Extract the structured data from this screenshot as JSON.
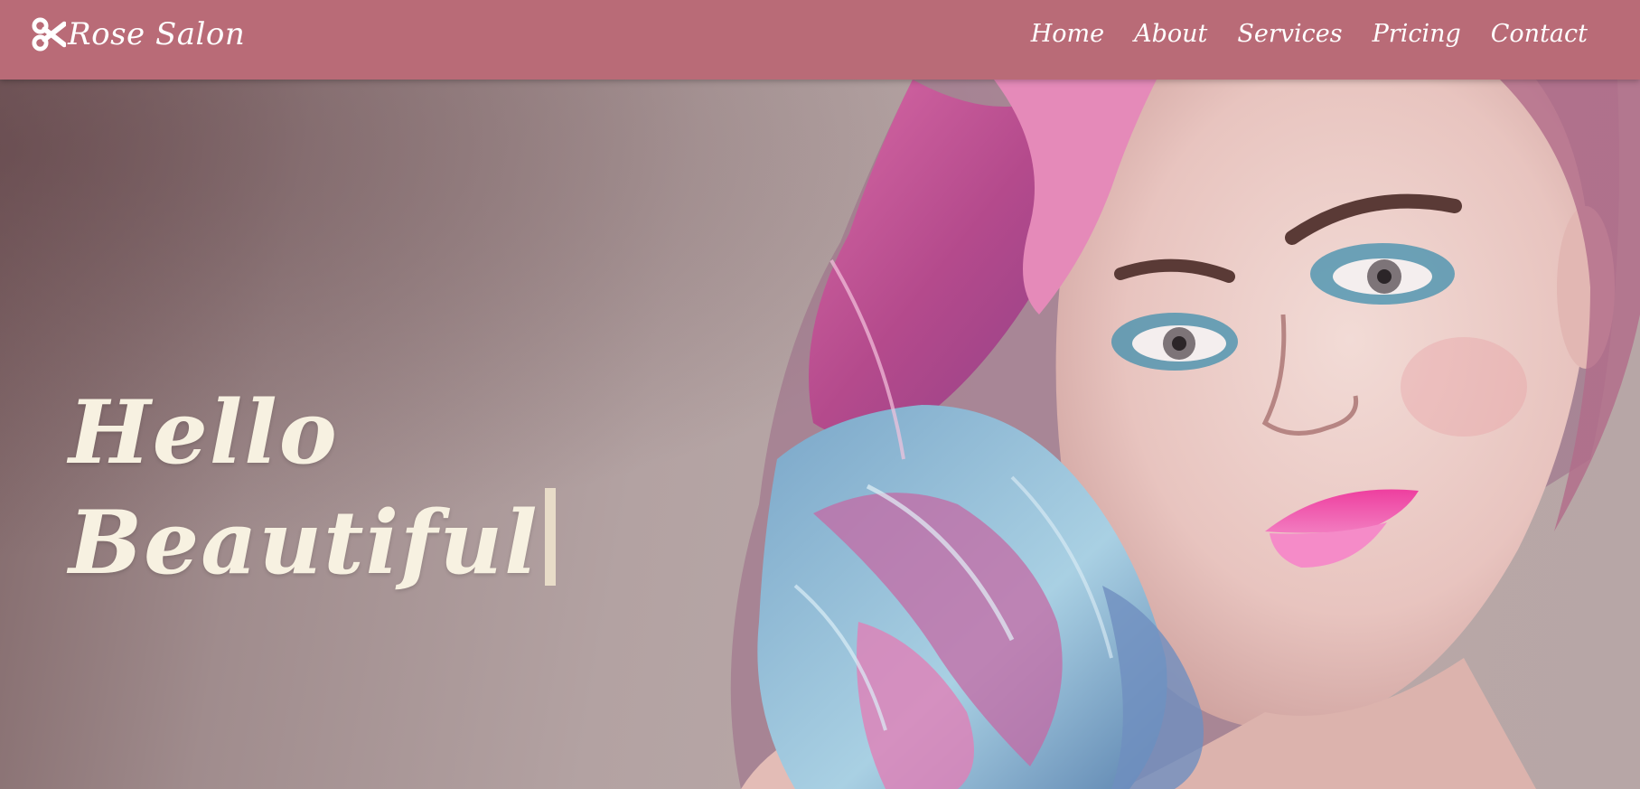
{
  "navbar": {
    "brand_icon": "scissors-icon",
    "brand_name": "Rose Salon",
    "links": [
      {
        "label": "Home"
      },
      {
        "label": "About"
      },
      {
        "label": "Services"
      },
      {
        "label": "Pricing"
      },
      {
        "label": "Contact"
      }
    ]
  },
  "hero": {
    "headline_line1": "Hello",
    "headline_line2": "Beautiful"
  },
  "colors": {
    "navbar_bg": "#b96b77",
    "hero_bg": "#b5a3a3",
    "headline_text": "#f7f1e1",
    "nav_text": "#ffffff"
  }
}
